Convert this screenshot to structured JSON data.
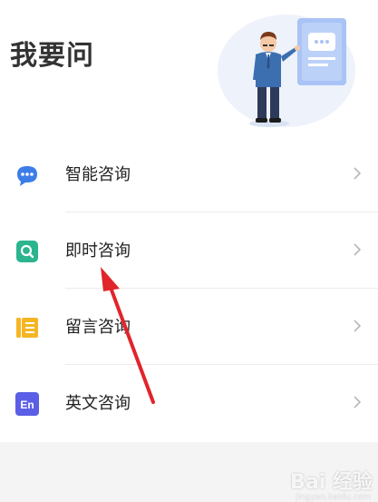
{
  "header": {
    "title": "我要问"
  },
  "menu": {
    "items": [
      {
        "label": "智能咨询",
        "icon": "chat-bubble-icon",
        "color": "#3d7de8"
      },
      {
        "label": "即时咨询",
        "icon": "search-window-icon",
        "color": "#2bb58f"
      },
      {
        "label": "留言咨询",
        "icon": "note-icon",
        "color": "#f5b625"
      },
      {
        "label": "英文咨询",
        "icon": "en-icon",
        "color": "#5a5fe6",
        "icon_text": "En"
      }
    ]
  },
  "watermark": {
    "text": "Bai 经验",
    "sub": "jingyan.baidu.com"
  },
  "colors": {
    "annotation_arrow": "#e0252b"
  }
}
